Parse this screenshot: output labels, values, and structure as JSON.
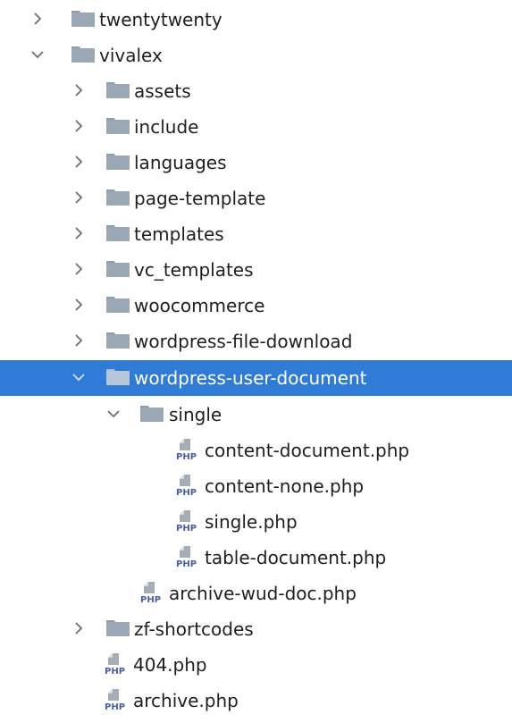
{
  "tree": {
    "items": [
      {
        "label": "twentytwenty",
        "type": "folder",
        "expanded": false,
        "icon": "folder-icon"
      },
      {
        "label": "vivalex",
        "type": "folder",
        "expanded": true,
        "icon": "folder-icon"
      },
      {
        "label": "assets",
        "type": "folder",
        "expanded": false,
        "icon": "folder-icon"
      },
      {
        "label": "include",
        "type": "folder",
        "expanded": false,
        "icon": "folder-icon"
      },
      {
        "label": "languages",
        "type": "folder",
        "expanded": false,
        "icon": "folder-icon"
      },
      {
        "label": "page-template",
        "type": "folder",
        "expanded": false,
        "icon": "folder-icon"
      },
      {
        "label": "templates",
        "type": "folder",
        "expanded": false,
        "icon": "folder-icon"
      },
      {
        "label": "vc_templates",
        "type": "folder",
        "expanded": false,
        "icon": "folder-icon"
      },
      {
        "label": "woocommerce",
        "type": "folder",
        "expanded": false,
        "icon": "folder-icon"
      },
      {
        "label": "wordpress-file-download",
        "type": "folder",
        "expanded": false,
        "icon": "folder-icon"
      },
      {
        "label": "wordpress-user-document",
        "type": "folder",
        "expanded": true,
        "selected": true,
        "icon": "folder-icon"
      },
      {
        "label": "single",
        "type": "folder",
        "expanded": true,
        "icon": "folder-icon"
      },
      {
        "label": "content-document.php",
        "type": "php-file",
        "icon": "php-file-icon"
      },
      {
        "label": "content-none.php",
        "type": "php-file",
        "icon": "php-file-icon"
      },
      {
        "label": "single.php",
        "type": "php-file",
        "icon": "php-file-icon"
      },
      {
        "label": "table-document.php",
        "type": "php-file",
        "icon": "php-file-icon"
      },
      {
        "label": "archive-wud-doc.php",
        "type": "php-file",
        "icon": "php-file-icon"
      },
      {
        "label": "zf-shortcodes",
        "type": "folder",
        "expanded": false,
        "icon": "folder-icon"
      },
      {
        "label": "404.php",
        "type": "php-file",
        "icon": "php-file-icon"
      },
      {
        "label": "archive.php",
        "type": "php-file",
        "icon": "php-file-icon"
      }
    ],
    "php_badge_text": "PHP"
  },
  "colors": {
    "selection": "#2f7bd6",
    "folder": "#9aa7b5",
    "chevron": "#6e6e6e",
    "php_badge": "#4a5fa8"
  }
}
